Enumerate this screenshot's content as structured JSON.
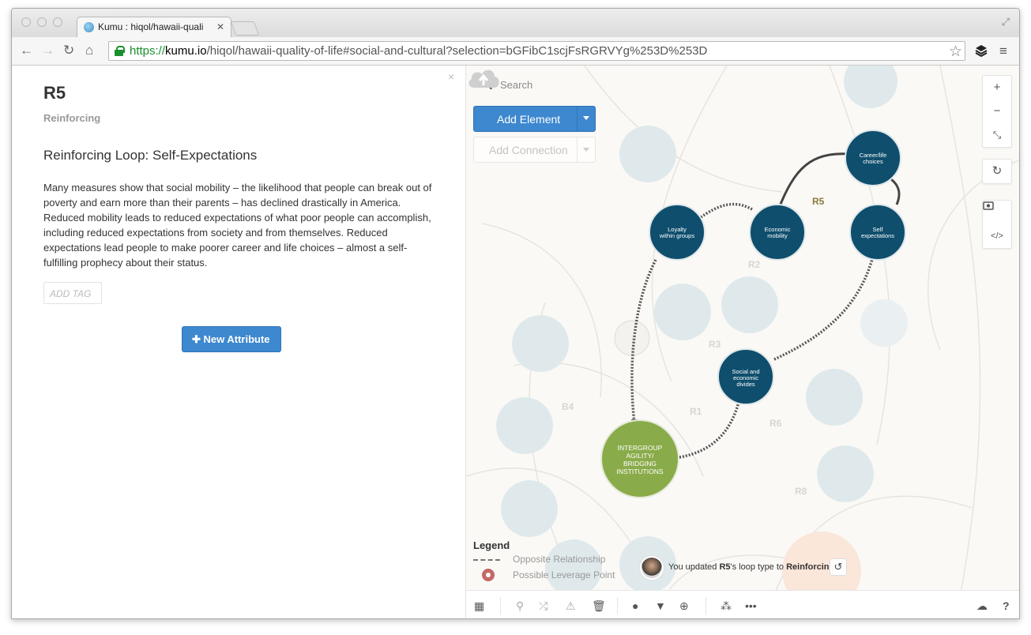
{
  "browser": {
    "tab_title": "Kumu : hiqol/hawaii-quali",
    "url_protocol": "https://",
    "url_host": "kumu.io",
    "url_path": "/hiqol/hawaii-quality-of-life#social-and-cultural?selection=bGFibC1scjFsRGRVYg%253D%253D"
  },
  "panel": {
    "title": "R5",
    "type": "Reinforcing",
    "loop_name": "Reinforcing Loop: Self-Expectations",
    "description": "Many measures show that social mobility – the likelihood that people can break out of poverty and earn more than their parents – has declined drastically in America. Reduced mobility leads to reduced expectations of what poor people can accomplish, including reduced expectations from society and from themselves. Reduced expectations lead people to make poorer career and life choices – almost a self-fulfilling prophecy about their status.",
    "add_tag_label": "ADD TAG",
    "new_attribute_label": "New Attribute",
    "close_glyph": "×"
  },
  "map": {
    "search_placeholder": "Search",
    "add_element_label": "Add Element",
    "add_connection_label": "Add Connection",
    "active_loop_label": "R5",
    "faded_loop_labels": [
      "R2",
      "R3",
      "B4",
      "R1",
      "R6",
      "R8"
    ],
    "nodes": [
      {
        "id": "career",
        "label_lines": [
          "Career/life",
          "choices"
        ],
        "color": "#0f4e6d"
      },
      {
        "id": "loyalty",
        "label_lines": [
          "Loyalty",
          "within groups"
        ],
        "color": "#0f4e6d"
      },
      {
        "id": "economic",
        "label_lines": [
          "Economic",
          "mobility"
        ],
        "color": "#0f4e6d"
      },
      {
        "id": "self",
        "label_lines": [
          "Self",
          "expectations"
        ],
        "color": "#0f4e6d"
      },
      {
        "id": "social",
        "label_lines": [
          "Social and",
          "economic",
          "divides"
        ],
        "color": "#0f4e6d"
      },
      {
        "id": "intergroup",
        "label_lines": [
          "INTERGROUP",
          "AGILITY/",
          "BRIDGING",
          "INSTITUTIONS"
        ],
        "color": "#8aab4a"
      }
    ],
    "legend": {
      "title": "Legend",
      "items": [
        "Opposite Relationship",
        "Possible Leverage Point"
      ]
    },
    "notification": {
      "prefix": "You updated ",
      "subject": "R5",
      "middle": "'s loop type to ",
      "value": "Reinforcing"
    }
  },
  "icons": {
    "back": "←",
    "forward": "→",
    "reload": "↻",
    "home": "⌂",
    "star": "☆",
    "menu": "≡",
    "zoom_in": "+",
    "zoom_out": "−",
    "collapse": "⤡",
    "refresh": "↻",
    "code": "</>",
    "undo": "↺"
  }
}
